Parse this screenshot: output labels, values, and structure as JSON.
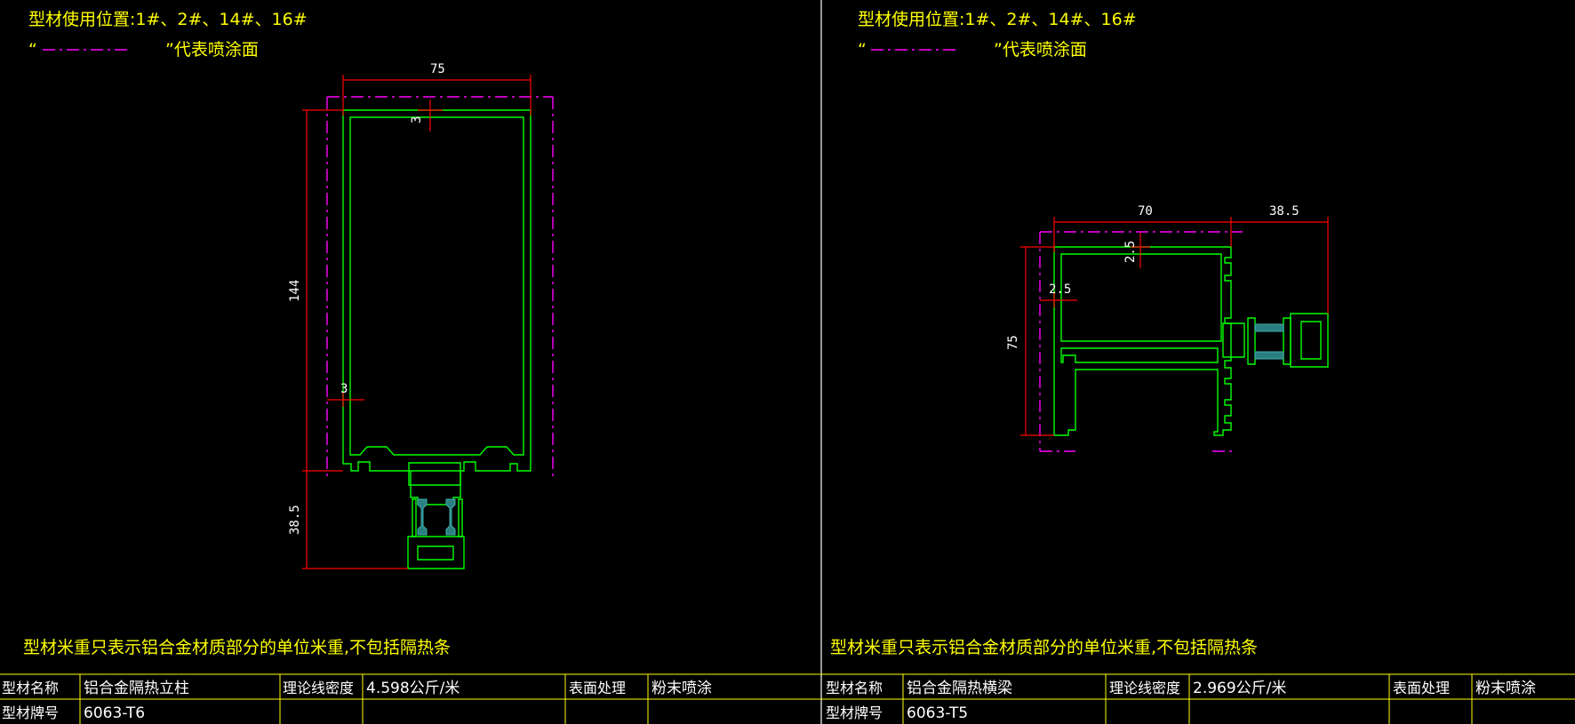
{
  "colors": {
    "background": "#000000",
    "profile": "#00ff00",
    "dimension": "#ff0000",
    "coating": "#ff00ff",
    "text": "#ffff00",
    "insulation": "#2a8080"
  },
  "left": {
    "usage_label": "型材使用位置:1#、2#、14#、16#",
    "legend_open_quote": "“",
    "legend_close_text": "”代表喷涂面",
    "dims": {
      "width_top": "75",
      "wall_top": "3",
      "height": "144",
      "wall_side": "3",
      "height_bottom": "38.5"
    },
    "note": "型材米重只表示铝合金材质部分的单位米重,不包括隔热条",
    "table": {
      "name_label": "型材名称",
      "name_value": "铝合金隔热立柱",
      "density_label": "理论线密度",
      "density_value": "4.598公斤/米",
      "surface_label": "表面处理",
      "surface_value": "粉末喷涂",
      "grade_label": "型材牌号",
      "grade_value": "6063-T6"
    }
  },
  "right": {
    "usage_label": "型材使用位置:1#、2#、14#、16#",
    "legend_open_quote": "“",
    "legend_close_text": "”代表喷涂面",
    "dims": {
      "width_top": "70",
      "width_ext": "38.5",
      "wall_top": "2.5",
      "wall_side": "2.5",
      "height": "75"
    },
    "note": "型材米重只表示铝合金材质部分的单位米重,不包括隔热条",
    "table": {
      "name_label": "型材名称",
      "name_value": "铝合金隔热横梁",
      "density_label": "理论线密度",
      "density_value": "2.969公斤/米",
      "surface_label": "表面处理",
      "surface_value": "粉末喷涂",
      "grade_label": "型材牌号",
      "grade_value": "6063-T5"
    }
  }
}
